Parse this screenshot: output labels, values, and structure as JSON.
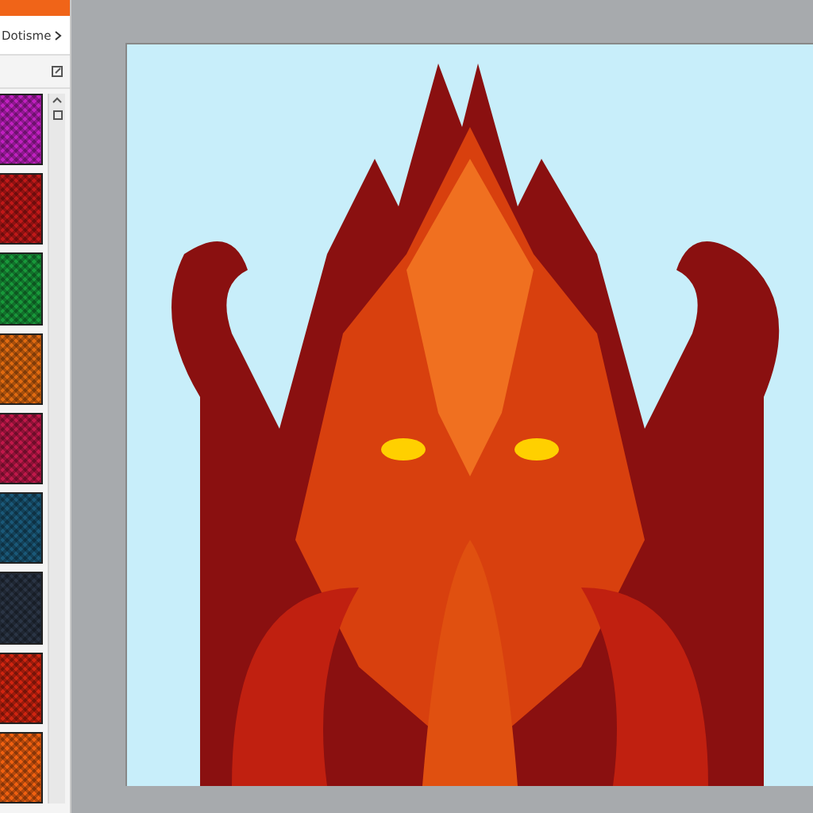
{
  "panel": {
    "title": "Dotisme",
    "swatches": [
      {
        "color": "#c020c0"
      },
      {
        "color": "#c01818"
      },
      {
        "color": "#18983a"
      },
      {
        "color": "#e06a10"
      },
      {
        "color": "#c0184a"
      },
      {
        "color": "#1a5878"
      },
      {
        "color": "#2a3444"
      },
      {
        "color": "#d02410"
      },
      {
        "color": "#f06010"
      }
    ]
  }
}
